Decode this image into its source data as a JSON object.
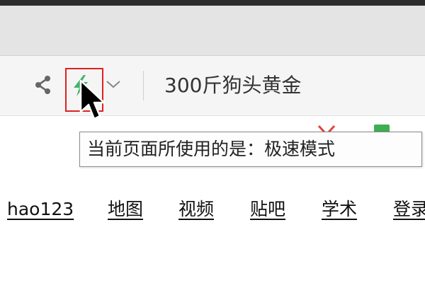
{
  "address_bar": {
    "share_icon": "share-icon",
    "mode_icon": "lightning-icon",
    "mode_icon_color": "#3fb56b",
    "dropdown_icon": "chevron-down-icon",
    "query_text": "300斤狗头黄金"
  },
  "tooltip": {
    "text": "当前页面所使用的是：极速模式"
  },
  "highlight_color": "#e02020",
  "nav": {
    "links": [
      "hao123",
      "地图",
      "视频",
      "贴吧",
      "学术",
      "登录"
    ]
  }
}
